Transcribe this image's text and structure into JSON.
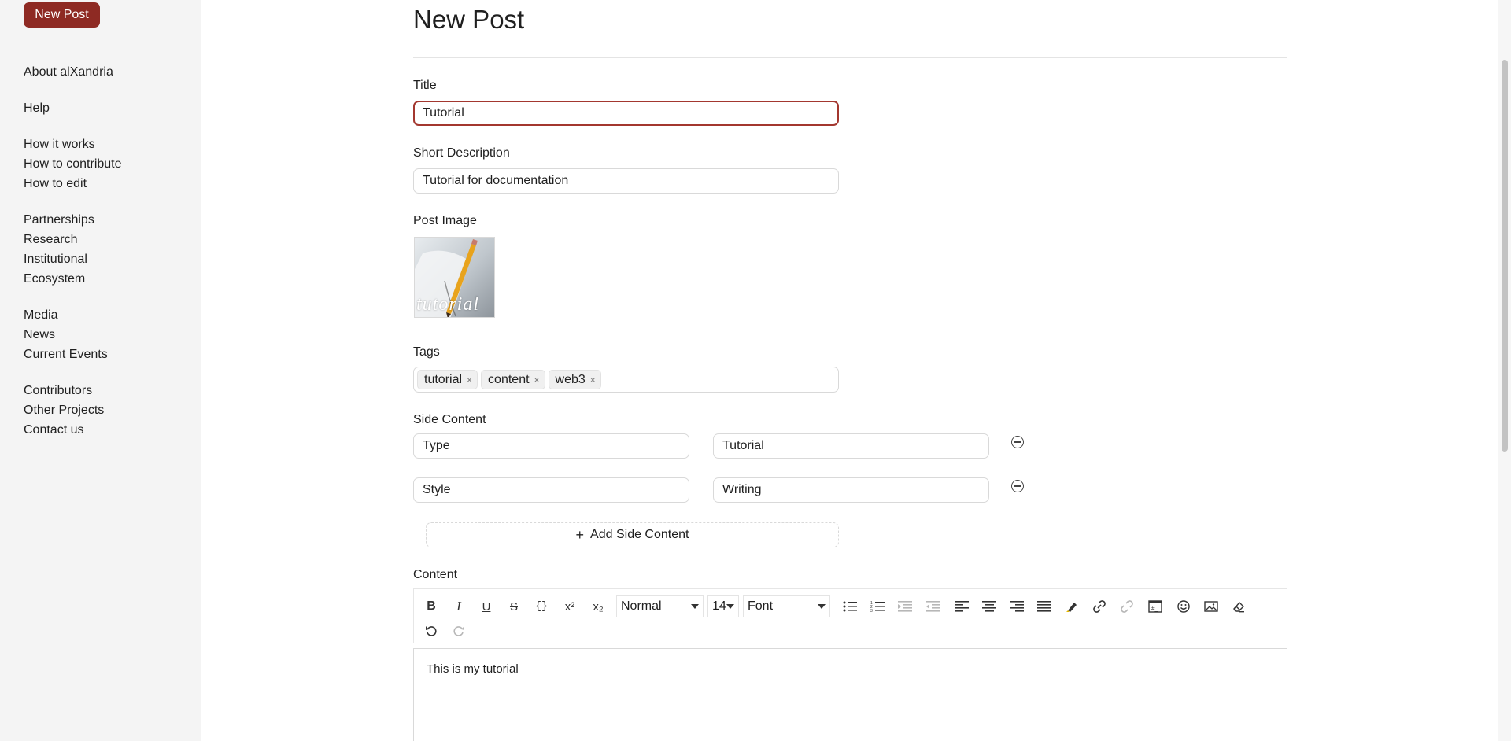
{
  "sidebar": {
    "new_post_label": "New Post",
    "groups": [
      [
        "About alXandria"
      ],
      [
        "Help"
      ],
      [
        "How it works",
        "How to contribute",
        "How to edit"
      ],
      [
        "Partnerships",
        "Research",
        "Institutional",
        "Ecosystem"
      ],
      [
        "Media",
        "News",
        "Current Events"
      ],
      [
        "Contributors",
        "Other Projects",
        "Contact us"
      ]
    ]
  },
  "form": {
    "page_title": "New Post",
    "title_label": "Title",
    "title_value": "Tutorial",
    "desc_label": "Short Description",
    "desc_value": "Tutorial for documentation",
    "image_label": "Post Image",
    "image_caption": "tutorial",
    "tags_label": "Tags",
    "tags": [
      "tutorial",
      "content",
      "web3"
    ],
    "side_label": "Side Content",
    "side_rows": [
      {
        "key": "Type",
        "value": "Tutorial"
      },
      {
        "key": "Style",
        "value": "Writing"
      }
    ],
    "add_side_label": "Add Side Content",
    "content_label": "Content",
    "editor": {
      "heading_select": "Normal",
      "size_select": "14",
      "font_select": "Font",
      "content_text": "This is my tutorial"
    }
  },
  "colors": {
    "accent": "#8e2a23",
    "sidebar_bg": "#f4f4f4"
  }
}
